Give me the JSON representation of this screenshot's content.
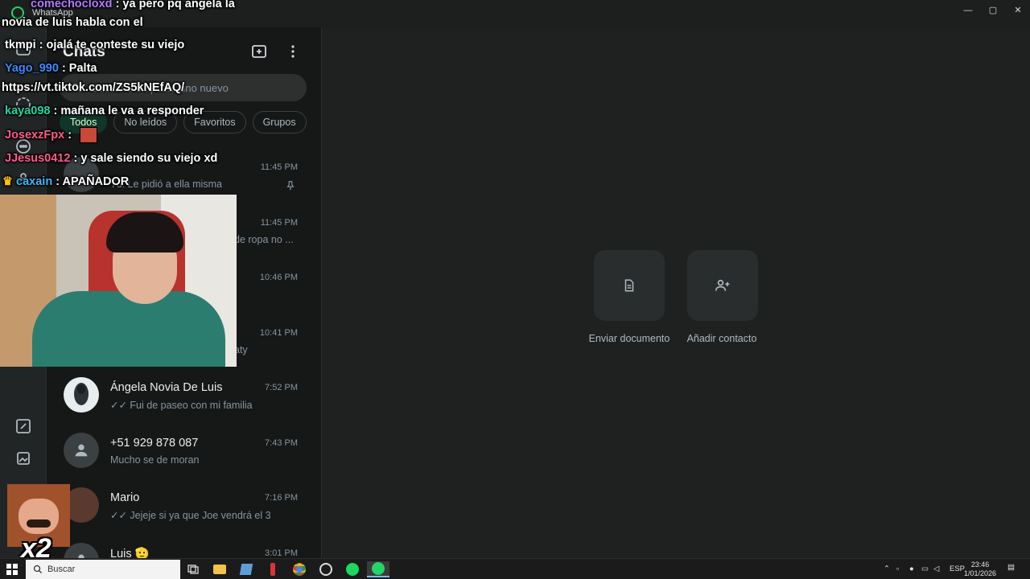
{
  "app": {
    "title": "WhatsApp",
    "accent": "#25d366"
  },
  "window_controls": {
    "minimize": "—",
    "maximize": "▢",
    "close": "✕"
  },
  "chatlist": {
    "title": "Chats",
    "search_placeholder": "Buscar o empezar uno nuevo",
    "filters": [
      "Todos",
      "No leídos",
      "Favoritos",
      "Grupos"
    ],
    "items": [
      {
        "name": "",
        "time": "11:45 PM",
        "last": "Tú: Le pidió a ella misma",
        "pinned": true
      },
      {
        "name": "",
        "time": "11:45 PM",
        "last": "de ropa no ..."
      },
      {
        "name": "",
        "time": "10:46 PM",
        "last": ""
      },
      {
        "name": "",
        "time": "10:41 PM",
        "last": "aty"
      },
      {
        "name": "Ángela Novia De Luis",
        "time": "7:52 PM",
        "last": "✓✓ Fui de paseo con mi familia"
      },
      {
        "name": "+51 929 878 087",
        "time": "7:43 PM",
        "last": "Mucho se de moran"
      },
      {
        "name": "Mario",
        "time": "7:16 PM",
        "last": "✓✓ Jejeje si ya que Joe vendrá el 3"
      },
      {
        "name": "Luis 🫡",
        "time": "3:01 PM",
        "last": ""
      }
    ]
  },
  "main": {
    "actions": [
      {
        "label": "Enviar documento",
        "icon": "document-icon"
      },
      {
        "label": "Añadir contacto",
        "icon": "add-contact-icon"
      }
    ]
  },
  "overlay": {
    "chat": [
      {
        "user": "comechocloxd",
        "user_color": "#b47bff",
        "text": ": ya pero pq angela la"
      },
      {
        "user": "",
        "user_color": "#ffffff",
        "text": "novia de luis habla con el"
      },
      {
        "user": "tkmpi",
        "user_color": "#ffffff",
        "text": ": ojalá te conteste su viejo"
      },
      {
        "user": "Yago_990",
        "user_color": "#3b8cff",
        "text": ": Palta"
      },
      {
        "user": "",
        "user_color": "#ffffff",
        "text": "https://vt.tiktok.com/ZS5kNEfAQ/"
      },
      {
        "user": "kaya098",
        "user_color": "#1fd8a6",
        "text": ": mañana le va a responder"
      },
      {
        "user": "JosexzFpx",
        "user_color": "#ff5b8a",
        "text": ":"
      },
      {
        "user": "JJesus0412",
        "user_color": "#ff5b8a",
        "text": ": y sale siendo su viejo xd"
      },
      {
        "user": "caxain",
        "user_color": "#3bb8ff",
        "text": ": APAÑADOR"
      }
    ],
    "multiplier": "x2"
  },
  "taskbar": {
    "search_label": "Buscar",
    "lang": "ESP",
    "time": "23:46",
    "date": "1/01/2026"
  }
}
